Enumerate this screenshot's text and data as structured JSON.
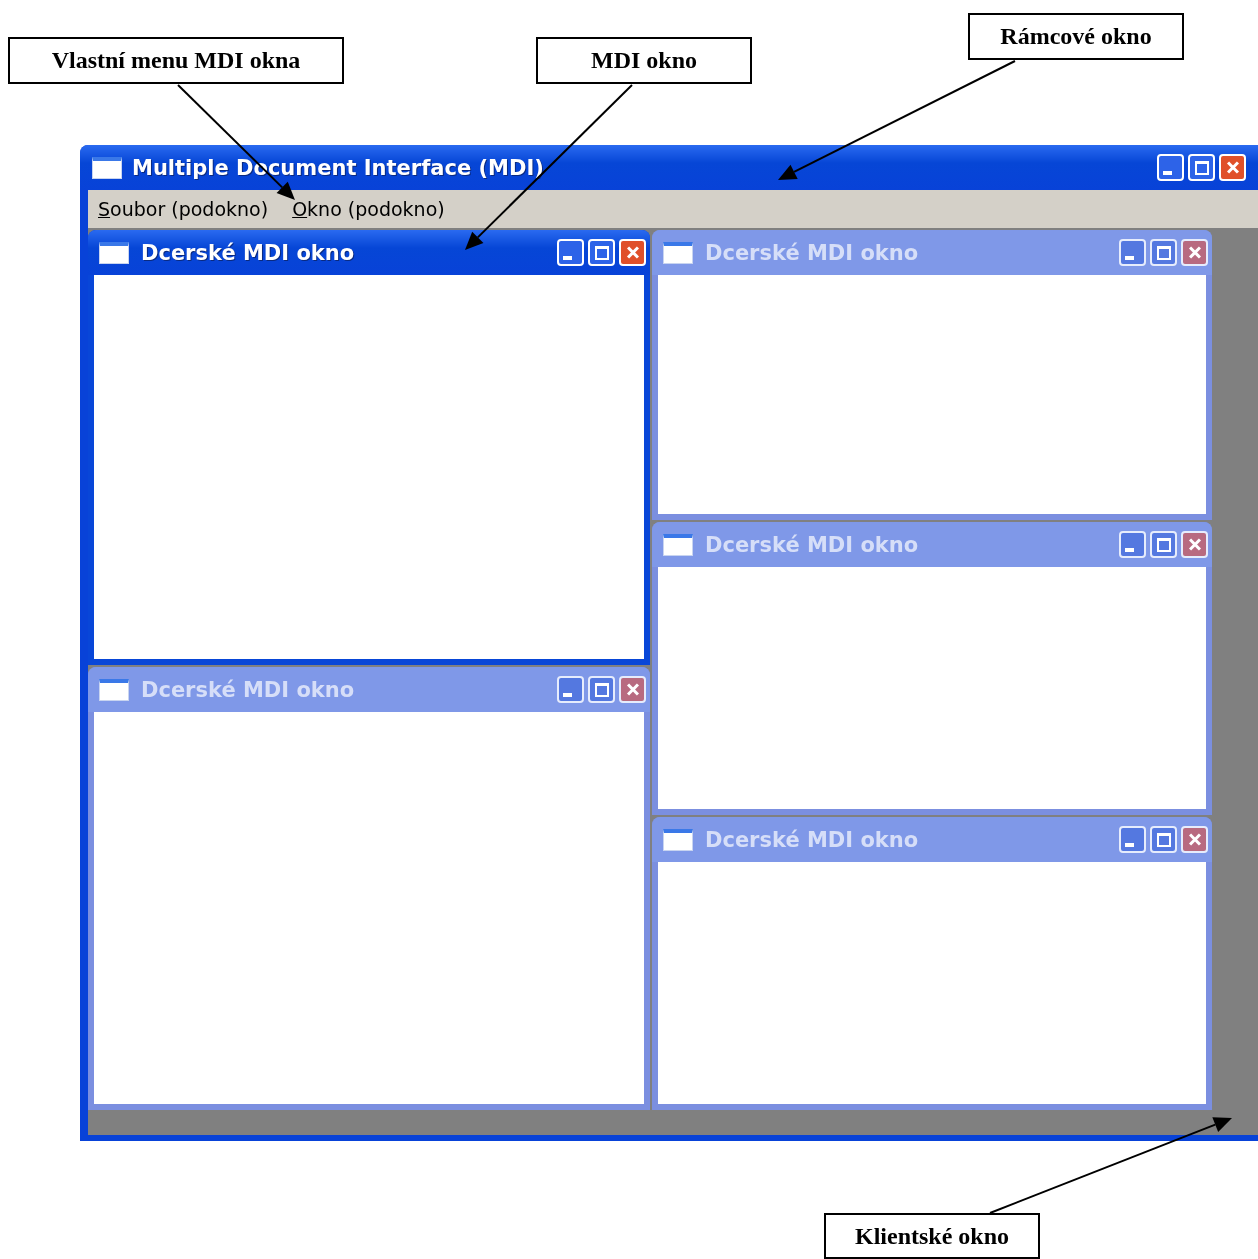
{
  "annotations": [
    {
      "text": "Vlastní menu MDI okna"
    },
    {
      "text": "MDI okno"
    },
    {
      "text": "Rámcové okno"
    },
    {
      "text": "Klientské okno"
    }
  ],
  "window": {
    "title": "Multiple Document Interface (MDI)"
  },
  "menu": [
    {
      "label": "Soubor (podokno)"
    },
    {
      "label": "Okno (podokno)"
    }
  ],
  "child_windows": {
    "left": [
      {
        "title": "Dcerské MDI okno",
        "active": true
      },
      {
        "title": "Dcerské MDI okno",
        "active": false
      }
    ],
    "right": [
      {
        "title": "Dcerské MDI okno",
        "active": false
      },
      {
        "title": "Dcerské MDI okno",
        "active": false
      },
      {
        "title": "Dcerské MDI okno",
        "active": false
      }
    ]
  }
}
